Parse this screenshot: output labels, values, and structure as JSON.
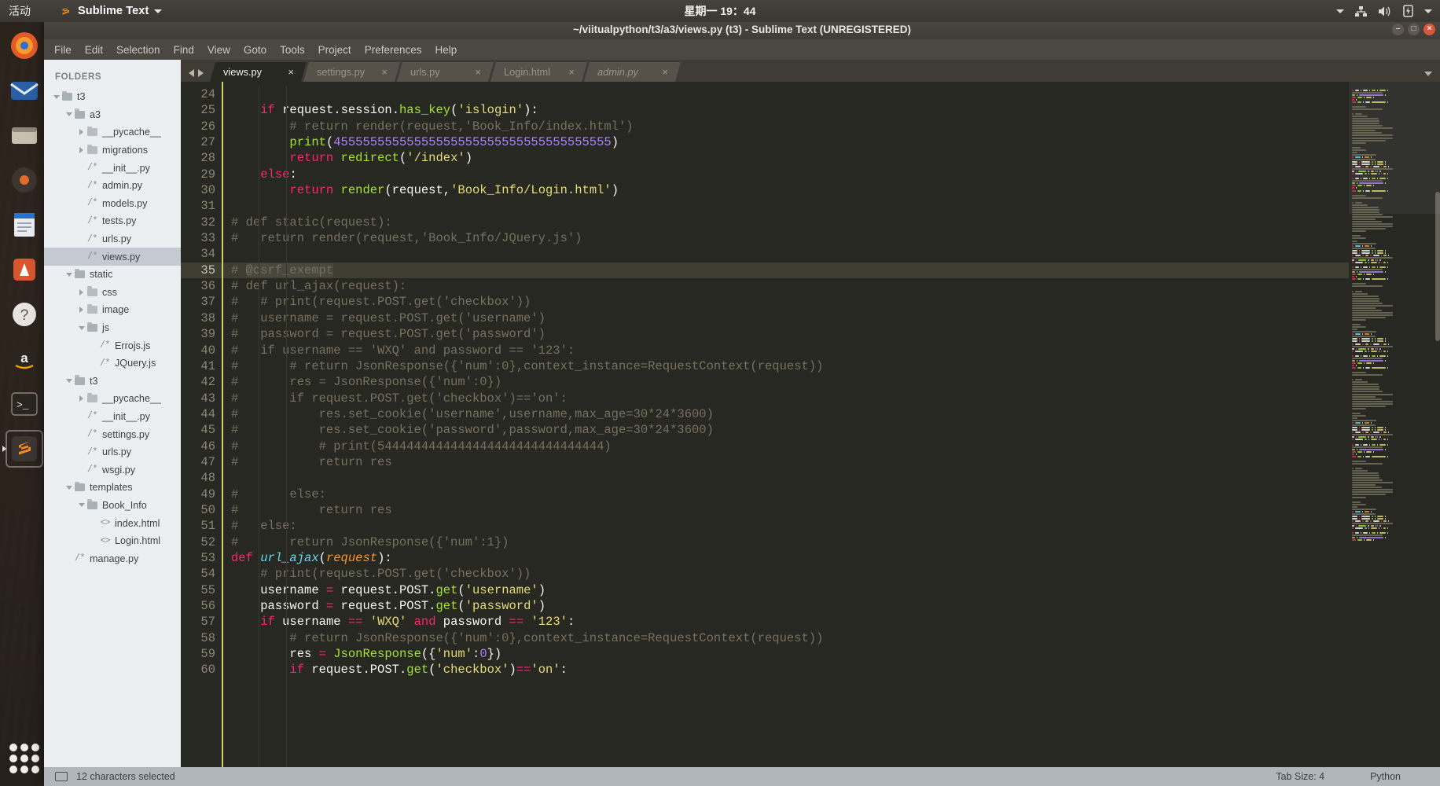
{
  "panel": {
    "activities": "活动",
    "app_name": "Sublime Text",
    "app_menu_caret": "▾",
    "clock": "星期一 19：44",
    "indicators": [
      "caret-down-icon",
      "network-icon",
      "volume-icon",
      "battery-icon",
      "system-menu-caret-icon"
    ]
  },
  "window": {
    "title": "~/viitualpython/t3/a3/views.py (t3) - Sublime Text (UNREGISTERED)",
    "buttons": {
      "minimize": "–",
      "maximize": "□",
      "close": "×"
    }
  },
  "menubar": [
    "File",
    "Edit",
    "Selection",
    "Find",
    "View",
    "Goto",
    "Tools",
    "Project",
    "Preferences",
    "Help"
  ],
  "sidebar": {
    "header": "FOLDERS",
    "items": [
      {
        "label": "t3",
        "indent": 0,
        "arrow": "down",
        "icon": "folder-open",
        "selected": false
      },
      {
        "label": "a3",
        "indent": 1,
        "arrow": "down",
        "icon": "folder-open",
        "selected": false
      },
      {
        "label": "__pycache__",
        "indent": 2,
        "arrow": "right",
        "icon": "folder-closed",
        "selected": false
      },
      {
        "label": "migrations",
        "indent": 2,
        "arrow": "right",
        "icon": "folder-closed",
        "selected": false
      },
      {
        "label": "__init__.py",
        "indent": 2,
        "arrow": "none",
        "icon": "py",
        "selected": false
      },
      {
        "label": "admin.py",
        "indent": 2,
        "arrow": "none",
        "icon": "py",
        "selected": false
      },
      {
        "label": "models.py",
        "indent": 2,
        "arrow": "none",
        "icon": "py",
        "selected": false
      },
      {
        "label": "tests.py",
        "indent": 2,
        "arrow": "none",
        "icon": "py",
        "selected": false
      },
      {
        "label": "urls.py",
        "indent": 2,
        "arrow": "none",
        "icon": "py",
        "selected": false
      },
      {
        "label": "views.py",
        "indent": 2,
        "arrow": "none",
        "icon": "py",
        "selected": true
      },
      {
        "label": "static",
        "indent": 1,
        "arrow": "down",
        "icon": "folder-open",
        "selected": false
      },
      {
        "label": "css",
        "indent": 2,
        "arrow": "right",
        "icon": "folder-closed",
        "selected": false
      },
      {
        "label": "image",
        "indent": 2,
        "arrow": "right",
        "icon": "folder-closed",
        "selected": false
      },
      {
        "label": "js",
        "indent": 2,
        "arrow": "down",
        "icon": "folder-open",
        "selected": false
      },
      {
        "label": "Errojs.js",
        "indent": 3,
        "arrow": "none",
        "icon": "py",
        "selected": false
      },
      {
        "label": "JQuery.js",
        "indent": 3,
        "arrow": "none",
        "icon": "py",
        "selected": false
      },
      {
        "label": "t3",
        "indent": 1,
        "arrow": "down",
        "icon": "folder-open",
        "selected": false
      },
      {
        "label": "__pycache__",
        "indent": 2,
        "arrow": "right",
        "icon": "folder-closed",
        "selected": false
      },
      {
        "label": "__init__.py",
        "indent": 2,
        "arrow": "none",
        "icon": "py",
        "selected": false
      },
      {
        "label": "settings.py",
        "indent": 2,
        "arrow": "none",
        "icon": "py",
        "selected": false
      },
      {
        "label": "urls.py",
        "indent": 2,
        "arrow": "none",
        "icon": "py",
        "selected": false
      },
      {
        "label": "wsgi.py",
        "indent": 2,
        "arrow": "none",
        "icon": "py",
        "selected": false
      },
      {
        "label": "templates",
        "indent": 1,
        "arrow": "down",
        "icon": "folder-open",
        "selected": false
      },
      {
        "label": "Book_Info",
        "indent": 2,
        "arrow": "down",
        "icon": "folder-open",
        "selected": false
      },
      {
        "label": "index.html",
        "indent": 3,
        "arrow": "none",
        "icon": "html",
        "selected": false
      },
      {
        "label": "Login.html",
        "indent": 3,
        "arrow": "none",
        "icon": "html",
        "selected": false
      },
      {
        "label": "manage.py",
        "indent": 1,
        "arrow": "none",
        "icon": "py",
        "selected": false
      }
    ]
  },
  "tabs": {
    "nav_prev": "prev-tab-arrow-icon",
    "nav_next": "next-tab-arrow-icon",
    "close_glyph": "×",
    "menu_glyph": "▾",
    "items": [
      {
        "label": "views.py",
        "active": true,
        "italic": false
      },
      {
        "label": "settings.py",
        "active": false,
        "italic": false
      },
      {
        "label": "urls.py",
        "active": false,
        "italic": false
      },
      {
        "label": "Login.html",
        "active": false,
        "italic": false
      },
      {
        "label": "admin.py",
        "active": false,
        "italic": true
      }
    ]
  },
  "editor": {
    "first_line": 24,
    "current_line": 35,
    "lines": [
      {
        "n": 24,
        "tokens": []
      },
      {
        "n": 25,
        "tokens": [
          {
            "t": "    ",
            "c": "t-plain"
          },
          {
            "t": "if",
            "c": "t-kw"
          },
          {
            "t": " request",
            "c": "t-plain"
          },
          {
            "t": ".",
            "c": "t-plain"
          },
          {
            "t": "session",
            "c": "t-plain"
          },
          {
            "t": ".",
            "c": "t-plain"
          },
          {
            "t": "has_key",
            "c": "t-fn"
          },
          {
            "t": "(",
            "c": "t-plain"
          },
          {
            "t": "'islogin'",
            "c": "t-str"
          },
          {
            "t": "):",
            "c": "t-plain"
          }
        ]
      },
      {
        "n": 26,
        "tokens": [
          {
            "t": "        # return render(request,'Book_Info/index.html')",
            "c": "t-cmt"
          }
        ]
      },
      {
        "n": 27,
        "tokens": [
          {
            "t": "        ",
            "c": "t-plain"
          },
          {
            "t": "print",
            "c": "t-fn"
          },
          {
            "t": "(",
            "c": "t-plain"
          },
          {
            "t": "45555555555555555555555555555555555555",
            "c": "t-num"
          },
          {
            "t": ")",
            "c": "t-plain"
          }
        ]
      },
      {
        "n": 28,
        "tokens": [
          {
            "t": "        ",
            "c": "t-plain"
          },
          {
            "t": "return",
            "c": "t-kw"
          },
          {
            "t": " ",
            "c": "t-plain"
          },
          {
            "t": "redirect",
            "c": "t-fn"
          },
          {
            "t": "(",
            "c": "t-plain"
          },
          {
            "t": "'/index'",
            "c": "t-str"
          },
          {
            "t": ")",
            "c": "t-plain"
          }
        ]
      },
      {
        "n": 29,
        "tokens": [
          {
            "t": "    ",
            "c": "t-plain"
          },
          {
            "t": "else",
            "c": "t-kw"
          },
          {
            "t": ":",
            "c": "t-plain"
          }
        ]
      },
      {
        "n": 30,
        "tokens": [
          {
            "t": "        ",
            "c": "t-plain"
          },
          {
            "t": "return",
            "c": "t-kw"
          },
          {
            "t": " ",
            "c": "t-plain"
          },
          {
            "t": "render",
            "c": "t-fn"
          },
          {
            "t": "(",
            "c": "t-plain"
          },
          {
            "t": "request,",
            "c": "t-plain"
          },
          {
            "t": "'Book_Info/Login.html'",
            "c": "t-str"
          },
          {
            "t": ")",
            "c": "t-plain"
          }
        ]
      },
      {
        "n": 31,
        "tokens": []
      },
      {
        "n": 32,
        "tokens": [
          {
            "t": "# def static(request):",
            "c": "t-cmt"
          }
        ]
      },
      {
        "n": 33,
        "tokens": [
          {
            "t": "#   return render(request,'Book_Info/JQuery.js')",
            "c": "t-cmt"
          }
        ]
      },
      {
        "n": 34,
        "tokens": []
      },
      {
        "n": 35,
        "tokens": [
          {
            "t": "# ",
            "c": "t-cmt"
          },
          {
            "t": "@csrf_exempt",
            "c": "t-cmt sel-hl"
          }
        ]
      },
      {
        "n": 36,
        "tokens": [
          {
            "t": "# def url_ajax(request):",
            "c": "t-cmt"
          }
        ]
      },
      {
        "n": 37,
        "tokens": [
          {
            "t": "#   # print(request.POST.get('checkbox'))",
            "c": "t-cmt"
          }
        ]
      },
      {
        "n": 38,
        "tokens": [
          {
            "t": "#   username = request.POST.get('username')",
            "c": "t-cmt"
          }
        ]
      },
      {
        "n": 39,
        "tokens": [
          {
            "t": "#   password = request.POST.get('password')",
            "c": "t-cmt"
          }
        ]
      },
      {
        "n": 40,
        "tokens": [
          {
            "t": "#   if username == 'WXQ' and password == '123':",
            "c": "t-cmt"
          }
        ]
      },
      {
        "n": 41,
        "tokens": [
          {
            "t": "#       # return JsonResponse({'num':0},context_instance=RequestContext(request))",
            "c": "t-cmt"
          }
        ]
      },
      {
        "n": 42,
        "tokens": [
          {
            "t": "#       res = JsonResponse({'num':0})",
            "c": "t-cmt"
          }
        ]
      },
      {
        "n": 43,
        "tokens": [
          {
            "t": "#       if request.POST.get('checkbox')=='on':",
            "c": "t-cmt"
          }
        ]
      },
      {
        "n": 44,
        "tokens": [
          {
            "t": "#           res.set_cookie('username',username,max_age=30*24*3600)",
            "c": "t-cmt"
          }
        ]
      },
      {
        "n": 45,
        "tokens": [
          {
            "t": "#           res.set_cookie('password',password,max_age=30*24*3600)",
            "c": "t-cmt"
          }
        ]
      },
      {
        "n": 46,
        "tokens": [
          {
            "t": "#           # print(5444444444444444444444444444444)",
            "c": "t-cmt"
          }
        ]
      },
      {
        "n": 47,
        "tokens": [
          {
            "t": "#           return res",
            "c": "t-cmt"
          }
        ]
      },
      {
        "n": 48,
        "tokens": []
      },
      {
        "n": 49,
        "tokens": [
          {
            "t": "#       else:",
            "c": "t-cmt"
          }
        ]
      },
      {
        "n": 50,
        "tokens": [
          {
            "t": "#           return res",
            "c": "t-cmt"
          }
        ]
      },
      {
        "n": 51,
        "tokens": [
          {
            "t": "#   else:",
            "c": "t-cmt"
          }
        ]
      },
      {
        "n": 52,
        "tokens": [
          {
            "t": "#       return JsonResponse({'num':1})",
            "c": "t-cmt"
          }
        ]
      },
      {
        "n": 53,
        "tokens": [
          {
            "t": "def",
            "c": "t-kw"
          },
          {
            "t": " ",
            "c": "t-plain"
          },
          {
            "t": "url_ajax",
            "c": "t-def"
          },
          {
            "t": "(",
            "c": "t-plain"
          },
          {
            "t": "request",
            "c": "t-param"
          },
          {
            "t": "):",
            "c": "t-plain"
          }
        ]
      },
      {
        "n": 54,
        "tokens": [
          {
            "t": "    # print(request.POST.get('checkbox'))",
            "c": "t-cmt"
          }
        ]
      },
      {
        "n": 55,
        "tokens": [
          {
            "t": "    username ",
            "c": "t-plain"
          },
          {
            "t": "=",
            "c": "t-op"
          },
          {
            "t": " request.POST.",
            "c": "t-plain"
          },
          {
            "t": "get",
            "c": "t-fn"
          },
          {
            "t": "(",
            "c": "t-plain"
          },
          {
            "t": "'username'",
            "c": "t-str"
          },
          {
            "t": ")",
            "c": "t-plain"
          }
        ]
      },
      {
        "n": 56,
        "tokens": [
          {
            "t": "    password ",
            "c": "t-plain"
          },
          {
            "t": "=",
            "c": "t-op"
          },
          {
            "t": " request.POST.",
            "c": "t-plain"
          },
          {
            "t": "get",
            "c": "t-fn"
          },
          {
            "t": "(",
            "c": "t-plain"
          },
          {
            "t": "'password'",
            "c": "t-str"
          },
          {
            "t": ")",
            "c": "t-plain"
          }
        ]
      },
      {
        "n": 57,
        "tokens": [
          {
            "t": "    ",
            "c": "t-plain"
          },
          {
            "t": "if",
            "c": "t-kw"
          },
          {
            "t": " username ",
            "c": "t-plain"
          },
          {
            "t": "==",
            "c": "t-op"
          },
          {
            "t": " ",
            "c": "t-plain"
          },
          {
            "t": "'WXQ'",
            "c": "t-str"
          },
          {
            "t": " ",
            "c": "t-plain"
          },
          {
            "t": "and",
            "c": "t-op"
          },
          {
            "t": " password ",
            "c": "t-plain"
          },
          {
            "t": "==",
            "c": "t-op"
          },
          {
            "t": " ",
            "c": "t-plain"
          },
          {
            "t": "'123'",
            "c": "t-str"
          },
          {
            "t": ":",
            "c": "t-plain"
          }
        ]
      },
      {
        "n": 58,
        "tokens": [
          {
            "t": "        # return JsonResponse({'num':0},context_instance=RequestContext(request))",
            "c": "t-cmt"
          }
        ]
      },
      {
        "n": 59,
        "tokens": [
          {
            "t": "        res ",
            "c": "t-plain"
          },
          {
            "t": "=",
            "c": "t-op"
          },
          {
            "t": " ",
            "c": "t-plain"
          },
          {
            "t": "JsonResponse",
            "c": "t-fn"
          },
          {
            "t": "({",
            "c": "t-plain"
          },
          {
            "t": "'num'",
            "c": "t-str"
          },
          {
            "t": ":",
            "c": "t-plain"
          },
          {
            "t": "0",
            "c": "t-num"
          },
          {
            "t": "})",
            "c": "t-plain"
          }
        ]
      },
      {
        "n": 60,
        "tokens": [
          {
            "t": "        ",
            "c": "t-plain"
          },
          {
            "t": "if",
            "c": "t-kw"
          },
          {
            "t": " request.POST.",
            "c": "t-plain"
          },
          {
            "t": "get",
            "c": "t-fn"
          },
          {
            "t": "(",
            "c": "t-plain"
          },
          {
            "t": "'checkbox'",
            "c": "t-str"
          },
          {
            "t": ")",
            "c": "t-plain"
          },
          {
            "t": "==",
            "c": "t-op"
          },
          {
            "t": "'on'",
            "c": "t-str"
          },
          {
            "t": ":",
            "c": "t-plain"
          }
        ]
      }
    ]
  },
  "statusbar": {
    "selection_text": "12 characters selected",
    "tab_size": "Tab Size: 4",
    "syntax": "Python"
  },
  "colors": {
    "accent": "#f92672",
    "editor_bg": "#272822",
    "sidebar_bg": "#eceff1",
    "status_bg": "#b0b6bc",
    "gutter_rule": "#cfd26a"
  }
}
